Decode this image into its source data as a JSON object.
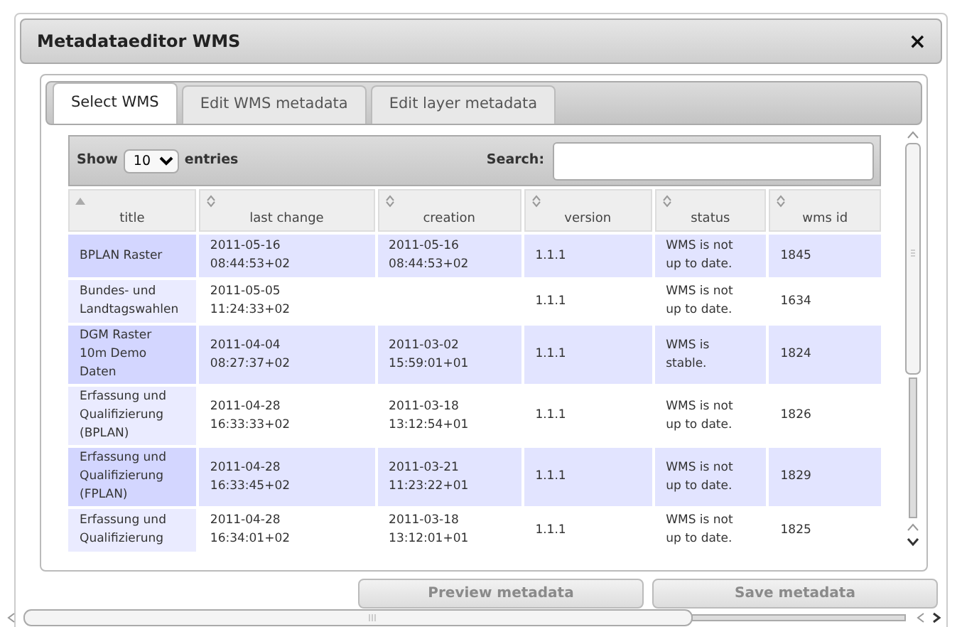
{
  "window": {
    "title": "Metadataeditor WMS",
    "close": "×"
  },
  "tabs": [
    {
      "label": "Select WMS",
      "selected": true
    },
    {
      "label": "Edit WMS metadata",
      "selected": false
    },
    {
      "label": "Edit layer metadata",
      "selected": false
    }
  ],
  "length_menu": {
    "before": "Show",
    "value": "10",
    "after": "entries"
  },
  "search": {
    "label": "Search:"
  },
  "table": {
    "columns": [
      {
        "label": "title",
        "sorted": true
      },
      {
        "label": "last change",
        "sorted": false
      },
      {
        "label": "creation",
        "sorted": false
      },
      {
        "label": "version",
        "sorted": false
      },
      {
        "label": "status",
        "sorted": false
      },
      {
        "label": "wms id",
        "sorted": false
      }
    ],
    "rows": [
      [
        "BPLAN Raster",
        "2011-05-16\n08:44:53+02",
        "2011-05-16\n08:44:53+02",
        "1.1.1",
        "WMS is not\nup to date.",
        "1845"
      ],
      [
        "Bundes- und\nLandtagswahlen",
        "2011-05-05\n11:24:33+02",
        "",
        "1.1.1",
        "WMS is not\nup to date.",
        "1634"
      ],
      [
        "DGM Raster\n10m Demo\nDaten",
        "2011-04-04\n08:27:37+02",
        "2011-03-02\n15:59:01+01",
        "1.1.1",
        "WMS is\nstable.",
        "1824"
      ],
      [
        "Erfassung und\nQualifizierung\n(BPLAN)",
        "2011-04-28\n16:33:33+02",
        "2011-03-18\n13:12:54+01",
        "1.1.1",
        "WMS is not\nup to date.",
        "1826"
      ],
      [
        "Erfassung und\nQualifizierung\n(FPLAN)",
        "2011-04-28\n16:33:45+02",
        "2011-03-21\n11:23:22+01",
        "1.1.1",
        "WMS is not\nup to date.",
        "1829"
      ],
      [
        "Erfassung und\nQualifizierung",
        "2011-04-28\n16:34:01+02",
        "2011-03-18\n13:12:01+01",
        "1.1.1",
        "WMS is not\nup to date.",
        "1825"
      ]
    ]
  },
  "buttons": [
    {
      "label": "Preview metadata",
      "disabled": true
    },
    {
      "label": "Save metadata",
      "disabled": true
    }
  ]
}
